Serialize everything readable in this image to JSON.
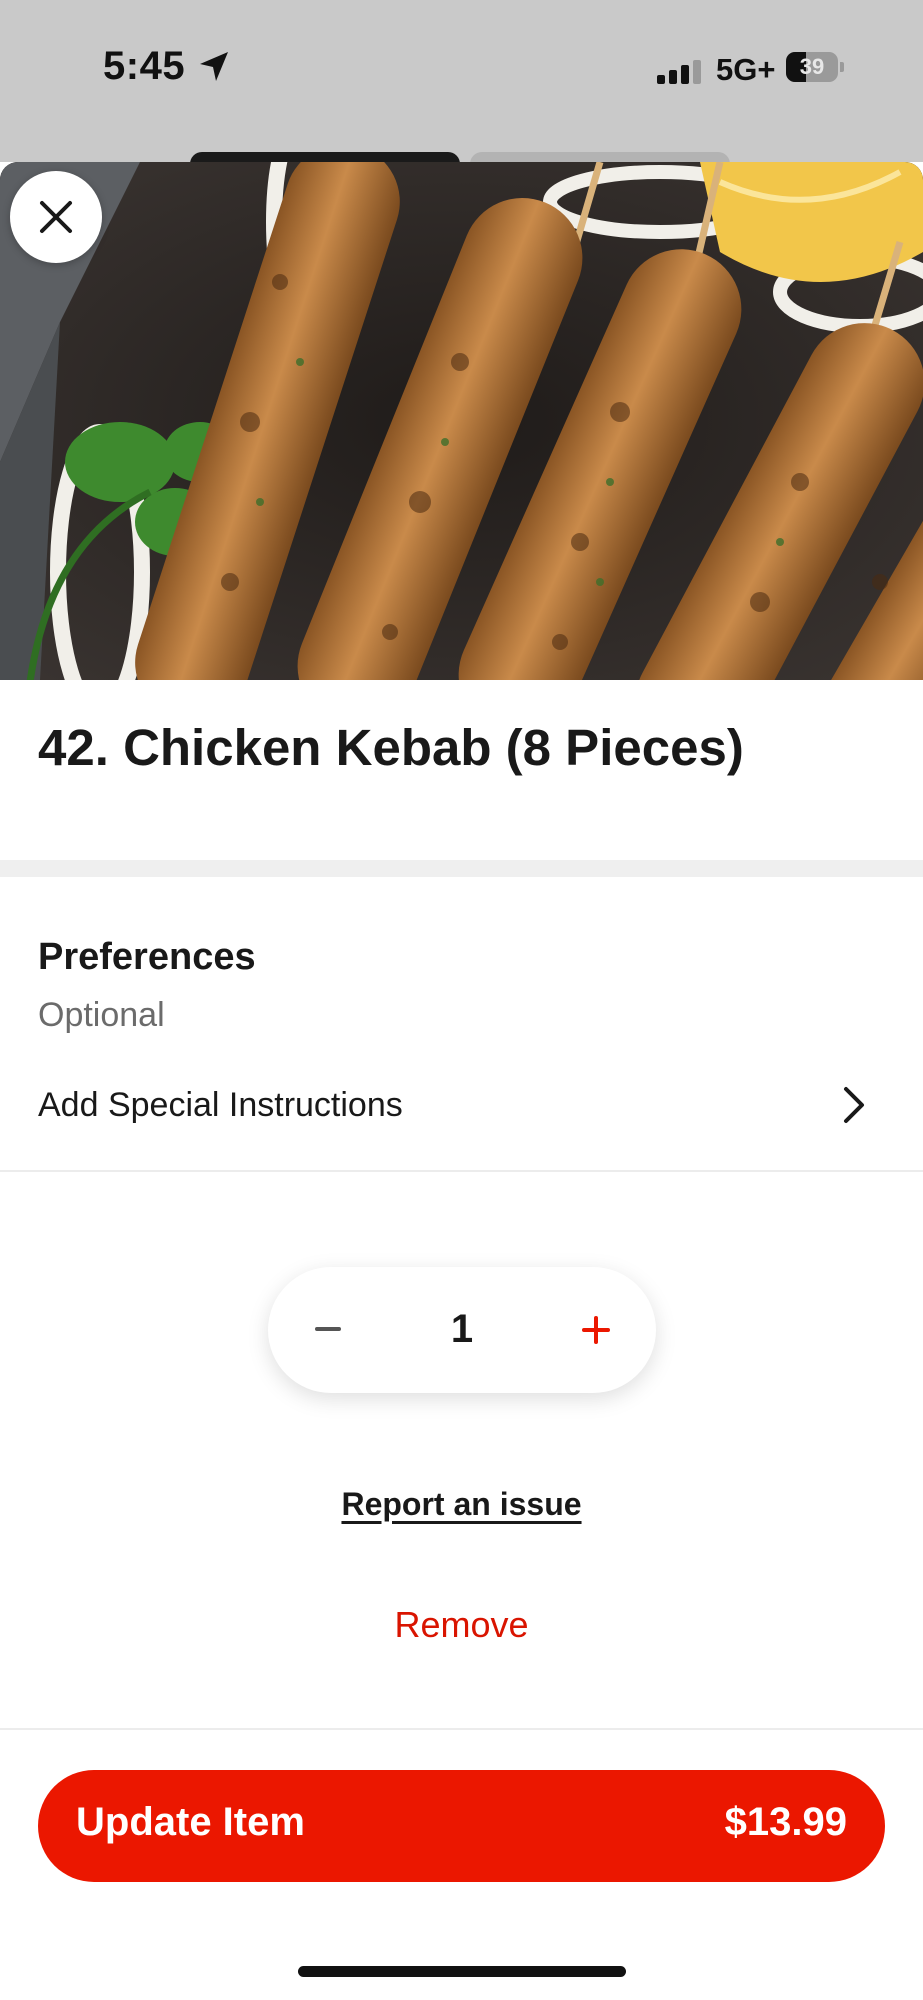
{
  "status_bar": {
    "time": "5:45",
    "network": "5G+",
    "battery": "39",
    "battery_level_percent": 39,
    "icons": [
      "location-arrow-icon",
      "signal-bars-icon",
      "battery-icon"
    ]
  },
  "hero": {
    "icon": "close-icon"
  },
  "item": {
    "title": "42. Chicken Kebab (8 Pieces)"
  },
  "preferences": {
    "heading": "Preferences",
    "subtitle": "Optional",
    "instructions_label": "Add Special Instructions",
    "icon": "chevron-right-icon"
  },
  "stepper": {
    "quantity": "1",
    "minus_icon": "minus-icon",
    "plus_icon": "plus-icon"
  },
  "actions": {
    "report_label": "Report an issue",
    "remove_label": "Remove"
  },
  "footer": {
    "update_label": "Update Item",
    "price": "$13.99"
  },
  "colors": {
    "accent": "#eb1700",
    "remove_text": "#d91400",
    "status_bar_bg": "#c9c9c9",
    "divider": "#efefef"
  }
}
